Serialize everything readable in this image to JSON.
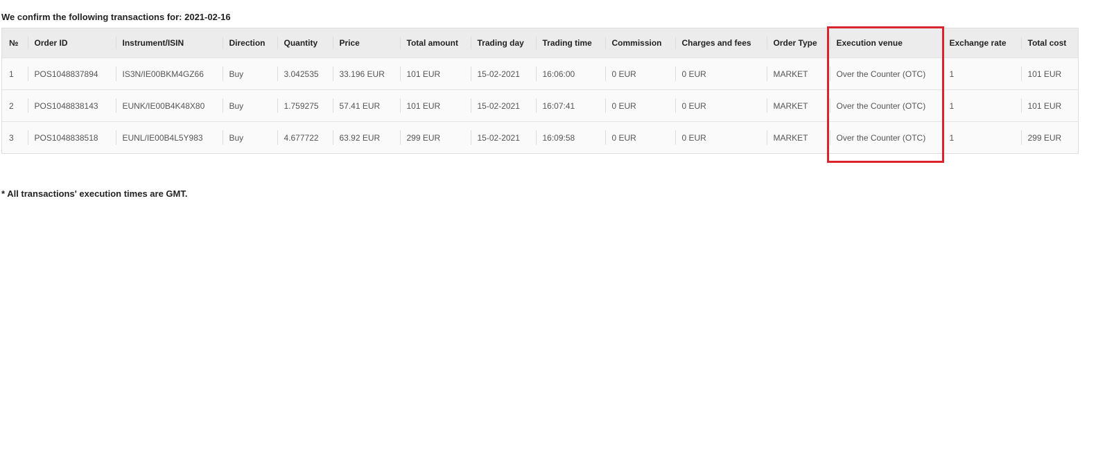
{
  "heading": "We confirm the following transactions for: 2021-02-16",
  "table": {
    "columns": [
      "№",
      "Order ID",
      "Instrument/ISIN",
      "Direction",
      "Quantity",
      "Price",
      "Total amount",
      "Trading day",
      "Trading time",
      "Commission",
      "Charges and fees",
      "Order Type",
      "Execution venue",
      "Exchange rate",
      "Total cost"
    ],
    "rows": [
      [
        "1",
        "POS1048837894",
        "IS3N/IE00BKM4GZ66",
        "Buy",
        "3.042535",
        "33.196 EUR",
        "101 EUR",
        "15-02-2021",
        "16:06:00",
        "0 EUR",
        "0 EUR",
        "MARKET",
        "Over the Counter (OTC)",
        "1",
        "101 EUR"
      ],
      [
        "2",
        "POS1048838143",
        "EUNK/IE00B4K48X80",
        "Buy",
        "1.759275",
        "57.41 EUR",
        "101 EUR",
        "15-02-2021",
        "16:07:41",
        "0 EUR",
        "0 EUR",
        "MARKET",
        "Over the Counter (OTC)",
        "1",
        "101 EUR"
      ],
      [
        "3",
        "POS1048838518",
        "EUNL/IE00B4L5Y983",
        "Buy",
        "4.677722",
        "63.92 EUR",
        "299 EUR",
        "15-02-2021",
        "16:09:58",
        "0 EUR",
        "0 EUR",
        "MARKET",
        "Over the Counter (OTC)",
        "1",
        "299 EUR"
      ]
    ]
  },
  "footnote": "* All transactions' execution times are GMT.",
  "colors": {
    "highlight": "#d9232d",
    "header_bg": "#ececec",
    "row_bg": "#fafafa"
  }
}
